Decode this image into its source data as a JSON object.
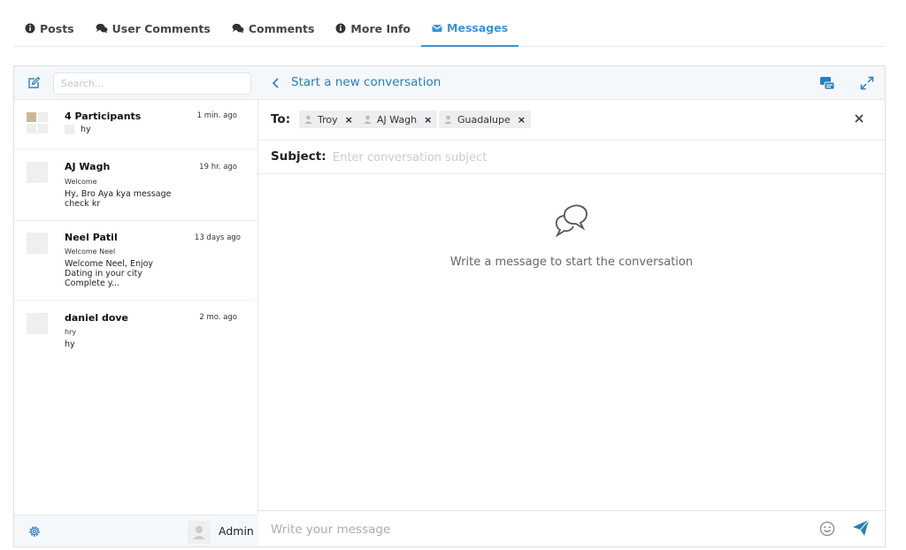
{
  "tabs": [
    {
      "label": "Posts",
      "icon": "info-circle-icon"
    },
    {
      "label": "User Comments",
      "icon": "comments-icon"
    },
    {
      "label": "Comments",
      "icon": "comments-icon"
    },
    {
      "label": "More Info",
      "icon": "info-circle-icon"
    },
    {
      "label": "Messages",
      "icon": "envelope-icon",
      "active": true
    }
  ],
  "sidebar": {
    "search_placeholder": "Search...",
    "conversations": [
      {
        "name": "4 Participants",
        "time": "1 min. ago",
        "subject": "",
        "message": "hy"
      },
      {
        "name": "AJ Wagh",
        "time": "19 hr. ago",
        "subject": "Welcome",
        "message": "Hy, Bro Aya kya message check kr"
      },
      {
        "name": "Neel Patil",
        "time": "13 days ago",
        "subject": "Welcome Neel",
        "message": "Welcome Neel, Enjoy Dating in your city Complete y..."
      },
      {
        "name": "daniel dove",
        "time": "2 mo. ago",
        "subject": "hry",
        "message": "hy"
      }
    ],
    "footer": {
      "user_name": "Admin"
    }
  },
  "conversation": {
    "header_title": "Start a new conversation",
    "to_label": "To:",
    "recipients": [
      "Troy",
      "AJ Wagh",
      "Guadalupe"
    ],
    "subject_label": "Subject:",
    "subject_placeholder": "Enter conversation subject",
    "empty_text": "Write a message to start the conversation",
    "message_placeholder": "Write your message"
  },
  "colors": {
    "accent": "#3a93d8",
    "link": "#2a7fba",
    "header_bg": "#f5f8fb"
  }
}
